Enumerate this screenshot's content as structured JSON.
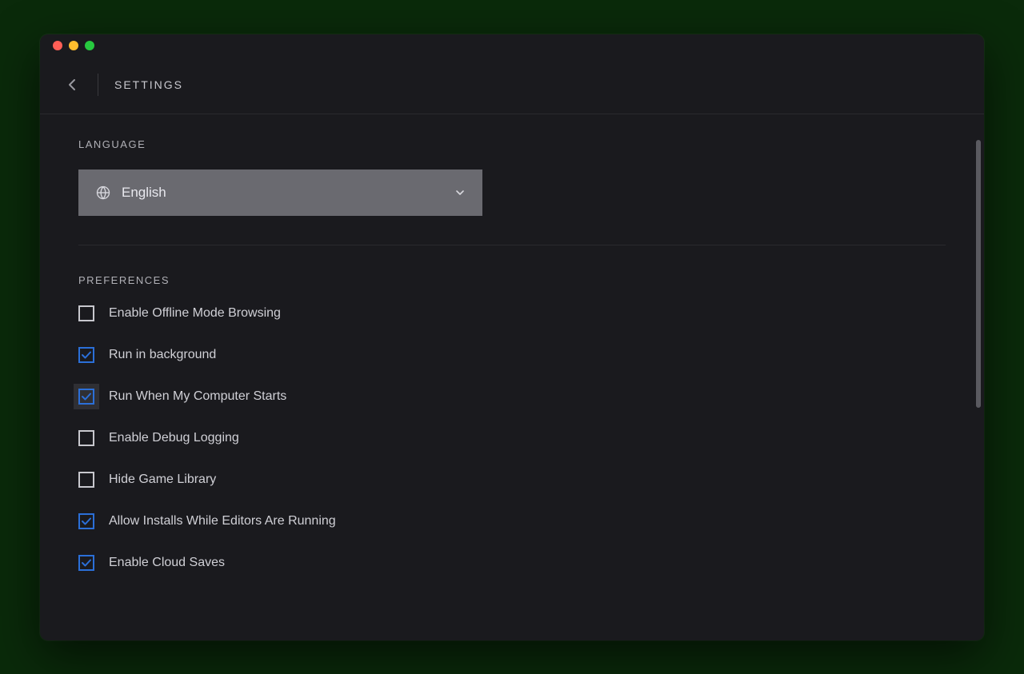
{
  "header": {
    "title": "SETTINGS"
  },
  "sections": {
    "language": {
      "label": "LANGUAGE",
      "selected": "English"
    },
    "preferences": {
      "label": "PREFERENCES",
      "items": [
        {
          "label": "Enable Offline Mode Browsing",
          "checked": false,
          "focused": false
        },
        {
          "label": "Run in background",
          "checked": true,
          "focused": false
        },
        {
          "label": "Run When My Computer Starts",
          "checked": true,
          "focused": true
        },
        {
          "label": "Enable Debug Logging",
          "checked": false,
          "focused": false
        },
        {
          "label": "Hide Game Library",
          "checked": false,
          "focused": false
        },
        {
          "label": "Allow Installs While Editors Are Running",
          "checked": true,
          "focused": false
        },
        {
          "label": "Enable Cloud Saves",
          "checked": true,
          "focused": false
        }
      ]
    }
  }
}
